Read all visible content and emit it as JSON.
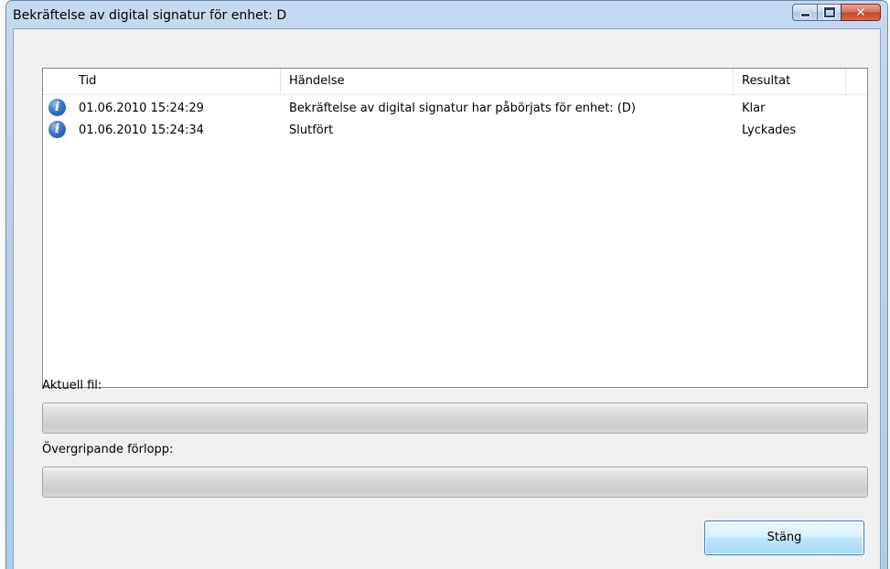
{
  "window": {
    "title": "Bekräftelse av digital signatur för enhet: D",
    "caption_buttons": {
      "minimize": "minimize-icon",
      "maximize": "maximize-icon",
      "close": "close-icon",
      "close_glyph": "✕"
    }
  },
  "log": {
    "columns": [
      "Tid",
      "Händelse",
      "Resultat"
    ],
    "rows": [
      {
        "icon": "info-icon",
        "icon_glyph": "i",
        "tid": "01.06.2010 15:24:29",
        "handelse": "Bekräftelse av digital signatur har påbörjats för enhet: (D)",
        "resultat": "Klar"
      },
      {
        "icon": "info-icon",
        "icon_glyph": "i",
        "tid": "01.06.2010 15:24:34",
        "handelse": "Slutfört",
        "resultat": "Lyckades"
      }
    ]
  },
  "progress": {
    "current_file_label": "Aktuell fil:",
    "current_file_value": 0,
    "overall_label": "Övergripande förlopp:",
    "overall_value": 0
  },
  "buttons": {
    "close_label": "Stäng"
  },
  "colors": {
    "titlebar": "#b9d1ec",
    "close_button": "#c4452b",
    "accent_button_border": "#3c7fb1"
  }
}
